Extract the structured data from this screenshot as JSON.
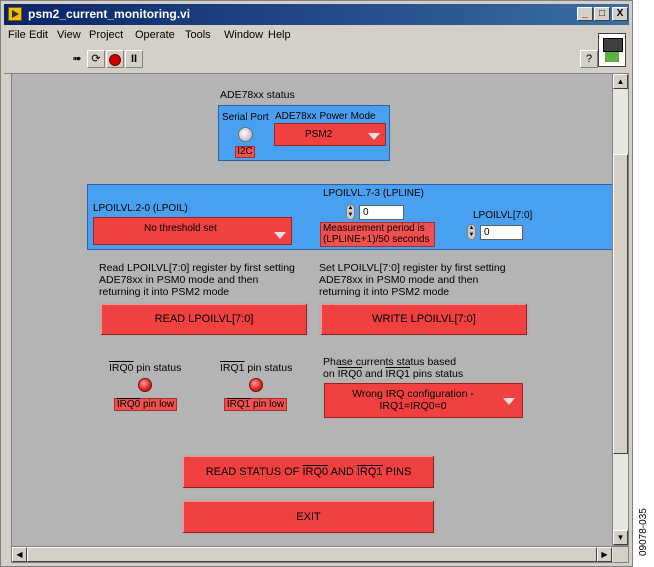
{
  "window": {
    "title": "psm2_current_monitoring.vi"
  },
  "titlebar_buttons": {
    "minimize": "_",
    "maximize": "□",
    "close": "X"
  },
  "menu": [
    "File",
    "Edit",
    "View",
    "Project",
    "Operate",
    "Tools",
    "Window",
    "Help"
  ],
  "toolbar": {
    "help_glyph": "?"
  },
  "status_panel": {
    "title": "ADE78xx status",
    "serial_port_label": "Serial Port",
    "serial_port_value": "I2C",
    "power_mode_label": "ADE78xx Power Mode",
    "power_mode_value": "PSM2"
  },
  "lpoil": {
    "lpoil_label": "LPOILVL.2-0 (LPOIL)",
    "lpoil_value": "No threshold set",
    "lpline_label": "LPOILVL.7-3 (LPLINE)",
    "lpline_value": "0",
    "measurement_note_1": "Measurement period is",
    "measurement_note_2": "(LPLINE+1)/50 seconds",
    "lpoilvl_label": "LPOILVL[7:0]",
    "lpoilvl_value": "0"
  },
  "read_section": {
    "desc_1": "Read LPOILVL[7:0] register by first setting",
    "desc_2": "ADE78xx in PSM0 mode and then",
    "desc_3": "returning it into PSM2 mode",
    "button": "READ LPOILVL[7:0]"
  },
  "write_section": {
    "desc_1": "Set LPOILVL[7:0] register by first setting",
    "desc_2": "ADE78xx in PSM0 mode and then",
    "desc_3": "returning it into PSM2 mode",
    "button": "WRITE LPOILVL[7:0]"
  },
  "irq0": {
    "pin": "IRQ0",
    "label_suffix": " pin status",
    "status_pin": "IRQ0",
    "status_suffix": " pin low"
  },
  "irq1": {
    "pin": "IRQ1",
    "label_suffix": " pin status",
    "status_pin": "IRQ1",
    "status_suffix": " pin low"
  },
  "phase": {
    "desc_1": "Phase currents status based",
    "desc_2_pre": "on ",
    "desc_2_irq0": "IRQ0",
    "desc_2_mid": " and ",
    "desc_2_irq1": "IRQ1",
    "desc_2_post": " pins status",
    "value_1": "Wrong IRQ configuration -",
    "value_2": "IRQ1=IRQ0=0"
  },
  "read_status_button": {
    "pre": "READ STATUS OF ",
    "irq0": "IRQ0",
    "mid": " AND ",
    "irq1": "IRQ1",
    "post": " PINS"
  },
  "exit_button": "EXIT",
  "figure_id": "09078-035",
  "colors": {
    "accent_red": "#f04040",
    "panel_blue": "#4aa0f0",
    "panel_gray": "#b4b4b4"
  }
}
